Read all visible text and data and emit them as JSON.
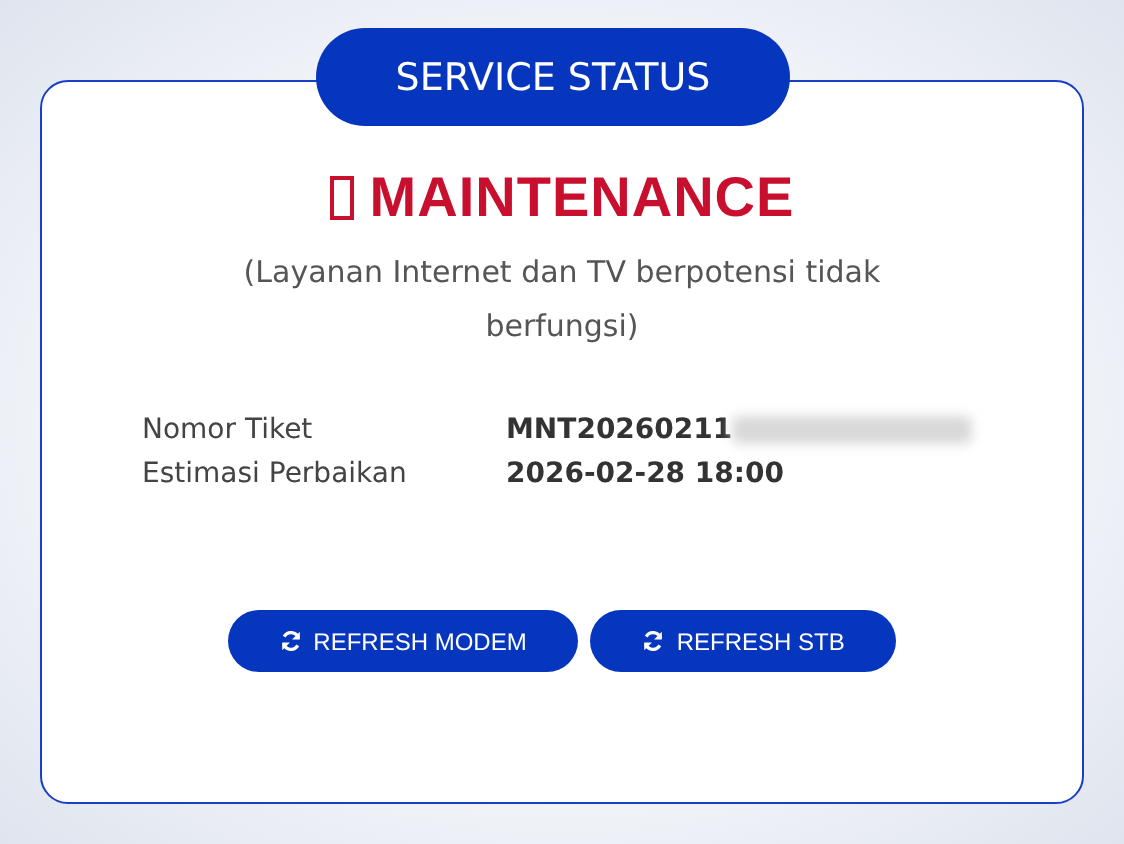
{
  "header": {
    "title": "SERVICE STATUS"
  },
  "status": {
    "kind": "maintenance",
    "label": "MAINTENANCE",
    "description": "(Layanan Internet dan TV berpotensi tidak berfungsi)"
  },
  "details": [
    {
      "label": "Nomor Tiket",
      "value": "MNT20260211",
      "redacted": true
    },
    {
      "label": "Estimasi Perbaikan",
      "value": "2026-02-28 18:00",
      "redacted": false
    }
  ],
  "buttons": [
    {
      "label": "REFRESH MODEM"
    },
    {
      "label": "REFRESH STB"
    }
  ]
}
